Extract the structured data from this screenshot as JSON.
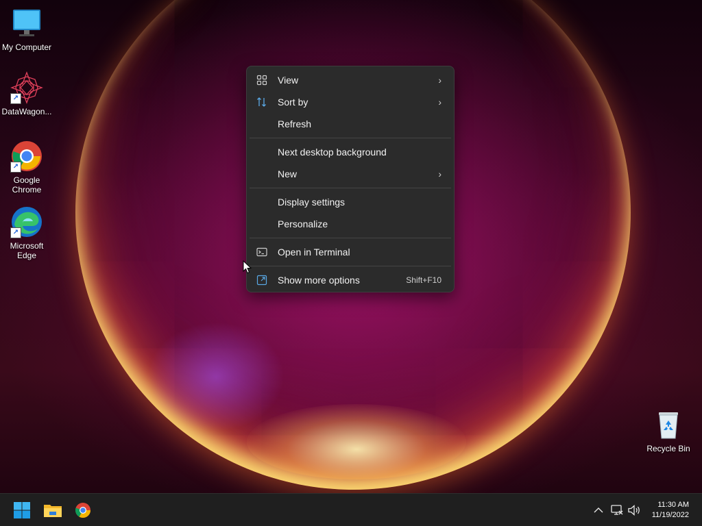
{
  "desktop": {
    "icons": [
      {
        "label": "My Computer"
      },
      {
        "label": "DataWagon..."
      },
      {
        "label": "Google Chrome"
      },
      {
        "label": "Microsoft Edge"
      },
      {
        "label": "Recycle Bin"
      }
    ]
  },
  "context_menu": {
    "items": [
      {
        "label": "View",
        "icon": "grid-view-icon",
        "submenu": true
      },
      {
        "label": "Sort by",
        "icon": "sort-icon",
        "submenu": true
      },
      {
        "label": "Refresh"
      },
      {
        "label": "Next desktop background"
      },
      {
        "label": "New",
        "submenu": true
      },
      {
        "label": "Display settings"
      },
      {
        "label": "Personalize"
      },
      {
        "label": "Open in Terminal",
        "icon": "terminal-icon"
      },
      {
        "label": "Show more options",
        "icon": "show-more-options-icon",
        "shortcut": "Shift+F10"
      }
    ]
  },
  "taskbar": {
    "apps": [
      "start-button",
      "file-explorer",
      "google-chrome"
    ],
    "tray": [
      "chevron-up-icon",
      "network-icon",
      "volume-icon"
    ],
    "clock": {
      "time": "11:30 AM",
      "date": "11/19/2022"
    }
  },
  "colors": {
    "menu_bg": "#2b2b2b",
    "taskbar_bg": "#1f1f1f",
    "windows_blue": "#0ea5e9"
  }
}
